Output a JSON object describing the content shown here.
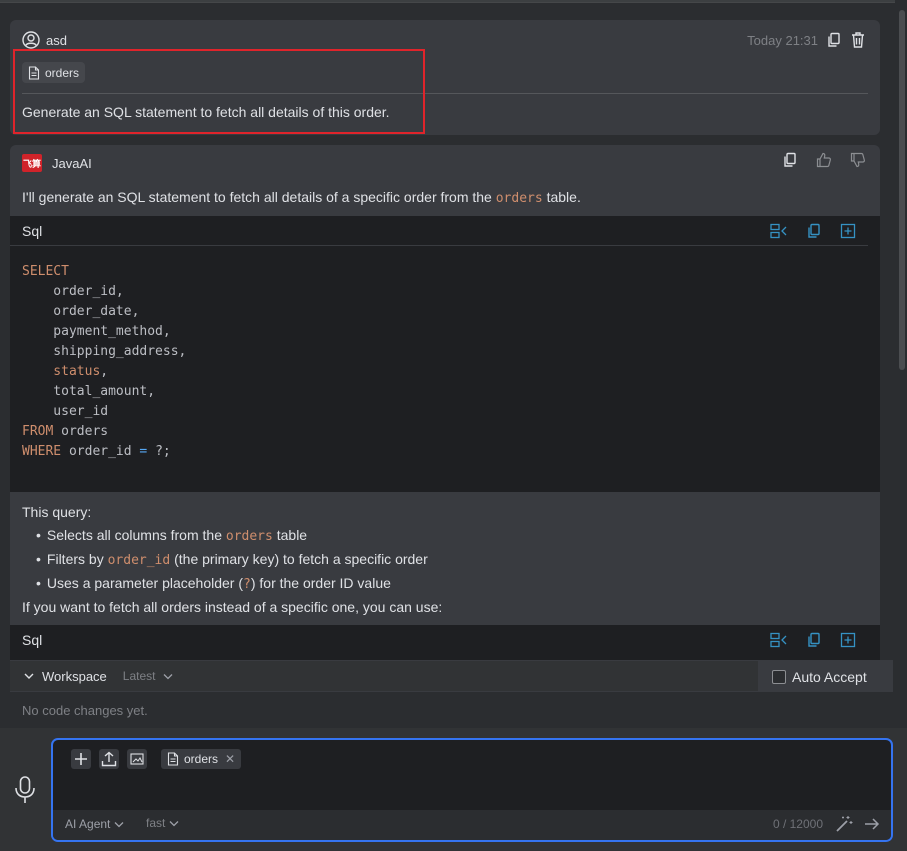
{
  "user_message": {
    "user": "asd",
    "timestamp": "Today 21:31",
    "attachment": "orders",
    "text": "Generate an SQL statement to fetch all details of this order."
  },
  "ai_message": {
    "name": "JavaAI",
    "logo_text": "飞算",
    "intro_before": "I'll generate an SQL statement to fetch all details of a specific order from the ",
    "intro_code": "orders",
    "intro_after": " table.",
    "code_block_1": {
      "lang": "Sql",
      "lines": [
        {
          "kw": "SELECT",
          "rest": ""
        },
        {
          "kw": "",
          "rest": "    order_id,"
        },
        {
          "kw": "",
          "rest": "    order_date,"
        },
        {
          "kw": "",
          "rest": "    payment_method,"
        },
        {
          "kw": "",
          "rest": "    shipping_address,"
        },
        {
          "kw": "",
          "status": "    status",
          "rest": ","
        },
        {
          "kw": "",
          "rest": "    total_amount,"
        },
        {
          "kw": "",
          "rest": "    user_id"
        },
        {
          "kw": "FROM",
          "rest": " orders"
        },
        {
          "kw": "WHERE",
          "rest": " order_id ",
          "op": "=",
          "rest2": " ?;"
        }
      ]
    },
    "explain_title": "This query:",
    "bullet_1_before": "Selects all columns from the ",
    "bullet_1_code": "orders",
    "bullet_1_after": " table",
    "bullet_2_before": "Filters by ",
    "bullet_2_code": "order_id",
    "bullet_2_after": " (the primary key) to fetch a specific order",
    "bullet_3_before": "Uses a parameter placeholder (",
    "bullet_3_code": "?",
    "bullet_3_after": ") for the order ID value",
    "followup": "If you want to fetch all orders instead of a specific one, you can use:",
    "code_block_2": {
      "lang": "Sql"
    }
  },
  "workspace": {
    "title": "Workspace",
    "version": "Latest",
    "auto_accept": "Auto Accept",
    "empty": "No code changes yet."
  },
  "input": {
    "attachment": "orders",
    "agent": "AI Agent",
    "speed": "fast",
    "counter": "0 / 12000"
  },
  "colors": {
    "accent": "#3574f0",
    "highlight": "#e0242b",
    "keyword": "#cf8e6d",
    "brand": "#d0232a"
  }
}
